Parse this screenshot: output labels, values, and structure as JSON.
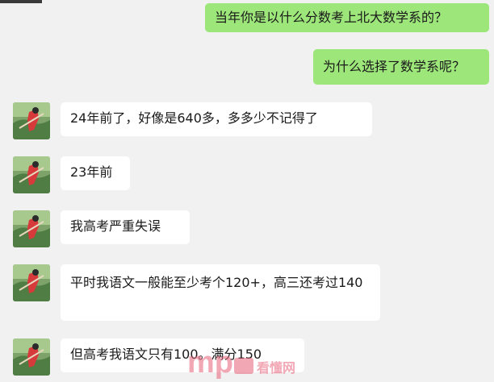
{
  "messages": [
    {
      "side": "right",
      "text": "当年你是以什么分数考上北大数学系的？"
    },
    {
      "side": "right",
      "text": "为什么选择了数学系呢？"
    },
    {
      "side": "left",
      "text": "24年前了，好像是640多，多多少不记得了"
    },
    {
      "side": "left",
      "text": "23年前"
    },
    {
      "side": "left",
      "text": "我高考严重失误"
    },
    {
      "side": "left",
      "text": "平时我语文一般能至少考个120+，高三还考过140"
    },
    {
      "side": "left",
      "text": "但高考我语文只有100。满分150"
    }
  ],
  "watermark": {
    "logo_text": "mp",
    "cn_text": "看懂网"
  },
  "colors": {
    "background": "#f1f1f1",
    "my_bubble": "#9de67a",
    "other_bubble": "#ffffff",
    "watermark": "#e9607a"
  },
  "icons": {
    "avatar": "contact-avatar-photo"
  }
}
